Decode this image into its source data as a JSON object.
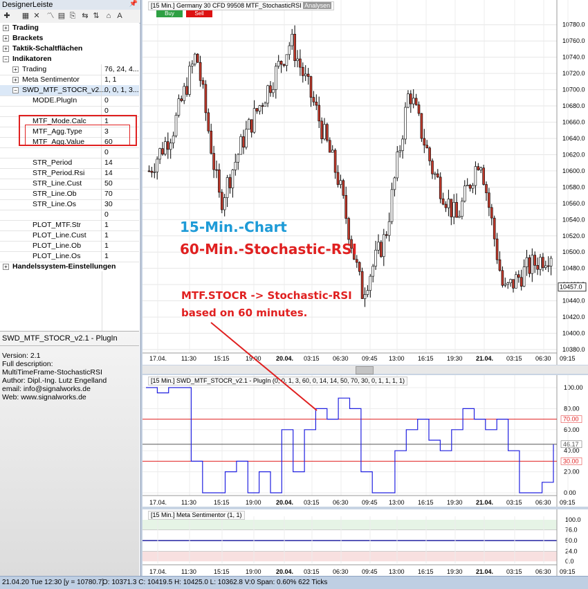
{
  "panel": {
    "title": "DesignerLeiste",
    "pin_icon": "pin-icon"
  },
  "tree": {
    "groups": [
      {
        "label": "Trading"
      },
      {
        "label": "Brackets"
      },
      {
        "label": "Taktik-Schaltflächen"
      },
      {
        "label": "Indikatoren"
      }
    ],
    "indicators": [
      {
        "label": "Trading",
        "value": "76, 24, 4..."
      },
      {
        "label": "Meta Sentimentor",
        "value": "1, 1"
      },
      {
        "label": "SWD_MTF_STOCR_v2...",
        "value": "0, 0, 1, 3..."
      }
    ],
    "params": [
      {
        "label": "MODE.PlugIn",
        "value": "0"
      },
      {
        "label": "",
        "value": "0"
      },
      {
        "label": "MTF_Mode.Calc",
        "value": "1"
      },
      {
        "label": "MTF_Agg.Type",
        "value": "3"
      },
      {
        "label": "MTF_Agg.Value",
        "value": "60"
      },
      {
        "label": "",
        "value": "0"
      },
      {
        "label": "STR_Period",
        "value": "14"
      },
      {
        "label": "STR_Period.Rsi",
        "value": "14"
      },
      {
        "label": "STR_Line.Cust",
        "value": "50"
      },
      {
        "label": "STR_Line.Ob",
        "value": "70"
      },
      {
        "label": "STR_Line.Os",
        "value": "30"
      },
      {
        "label": "",
        "value": "0"
      },
      {
        "label": "PLOT_MTF.Str",
        "value": "1"
      },
      {
        "label": "PLOT_Line.Cust",
        "value": "1"
      },
      {
        "label": "PLOT_Line.Ob",
        "value": "1"
      },
      {
        "label": "PLOT_Line.Os",
        "value": "1"
      }
    ],
    "last_group": "Handelssystem-Einstellungen"
  },
  "info": {
    "title": "SWD_MTF_STOCR_v2.1 - PlugIn",
    "lines": [
      "Version: 2.1",
      "Full description:",
      "MultiTimeFrame-StochasticRSI",
      "Author: Dipl.-Ing. Lutz Engelland",
      "email: info@signalworks.de",
      "Web: www.signalworks.de"
    ]
  },
  "chart1": {
    "header": "[15 Min.] Germany 30 CFD   99508 MTF_StochasticRSI",
    "analysen": "Analysen",
    "buy": "Buy",
    "sell": "Sell",
    "yticks": [
      "10780.0",
      "10760.0",
      "10740.0",
      "10720.0",
      "10700.0",
      "10680.0",
      "10660.0",
      "10640.0",
      "10620.0",
      "10600.0",
      "10580.0",
      "10560.0",
      "10540.0",
      "10520.0",
      "10500.0",
      "10480.0",
      "10460.0",
      "10440.0",
      "10420.0",
      "10400.0",
      "10380.0"
    ],
    "last_price": "10457.0",
    "annotation_title1": "15-Min.-Chart",
    "annotation_title2": "60-Min.-Stochastic-RSI",
    "annotation_note1": "MTF.STOCR -> Stochastic-RSI",
    "annotation_note2": "based on 60 minutes."
  },
  "xticks": [
    "17.04.",
    "11:30",
    "15:15",
    "19:00",
    "20.04.",
    "03:15",
    "06:30",
    "09:45",
    "13:00",
    "16:15",
    "19:30",
    "21.04.",
    "03:15",
    "06:30",
    "09:15"
  ],
  "chart2": {
    "header": "[15 Min.] SWD_MTF_STOCR_v2.1 - PlugIn  (0, 0, 1, 3, 60, 0, 14, 14, 50, 70, 30, 0, 1, 1, 1, 1)",
    "yticks": [
      "100.00",
      "80.00",
      "60.00",
      "40.00",
      "20.00",
      "0.00"
    ],
    "ob_label": "70.00",
    "cust_label": "46.17",
    "os_label": "30.00"
  },
  "chart3": {
    "header": "[15 Min.] Meta Sentimentor  (1, 1)",
    "yticks": [
      "100.0",
      "76.0",
      "50.0",
      "24.0",
      "0.0"
    ]
  },
  "status": {
    "datetime": "21.04.20 Tue  12:30 [y = 10780.7]",
    "ohlc": "O: 10371.3 C: 10419.5 H: 10425.0 L: 10362.8 V:0 Span: 0.60% 622 Ticks"
  },
  "chart_data": [
    {
      "type": "candlestick",
      "y_range": [
        10380,
        10790
      ],
      "x": [
        "17.04.",
        "11:30",
        "15:15",
        "19:00",
        "20.04.",
        "03:15",
        "06:30",
        "09:45",
        "13:00",
        "16:15",
        "19:30",
        "21.04.",
        "03:15",
        "06:30",
        "09:15"
      ],
      "approx_closes": [
        10600,
        10650,
        10745,
        10560,
        10640,
        10700,
        10760,
        10680,
        10590,
        10450,
        10520,
        10700,
        10600,
        10540,
        10620,
        10450,
        10480,
        10500
      ],
      "last_value": 10457.0
    },
    {
      "type": "line",
      "series": [
        {
          "name": "MTF_StochasticRSI",
          "values": [
            100,
            95,
            100,
            100,
            30,
            0,
            0,
            20,
            30,
            0,
            20,
            0,
            60,
            20,
            60,
            80,
            70,
            90,
            80,
            20,
            0,
            0,
            40,
            60,
            70,
            50,
            40,
            60,
            80,
            70,
            60,
            70,
            40,
            0,
            0,
            10,
            46
          ]
        }
      ],
      "ylim": [
        0,
        100
      ],
      "levels": [
        70,
        46.17,
        30
      ]
    },
    {
      "type": "line",
      "title": "Meta Sentimentor",
      "ylim": [
        0,
        100
      ],
      "levels": [
        76,
        50,
        24
      ]
    }
  ],
  "colors": {
    "accent_blue": "#1e9bd7",
    "accent_red": "#e02020",
    "line_blue": "#2020e0",
    "bull": "#ffffff",
    "bear": "#c0392b"
  }
}
